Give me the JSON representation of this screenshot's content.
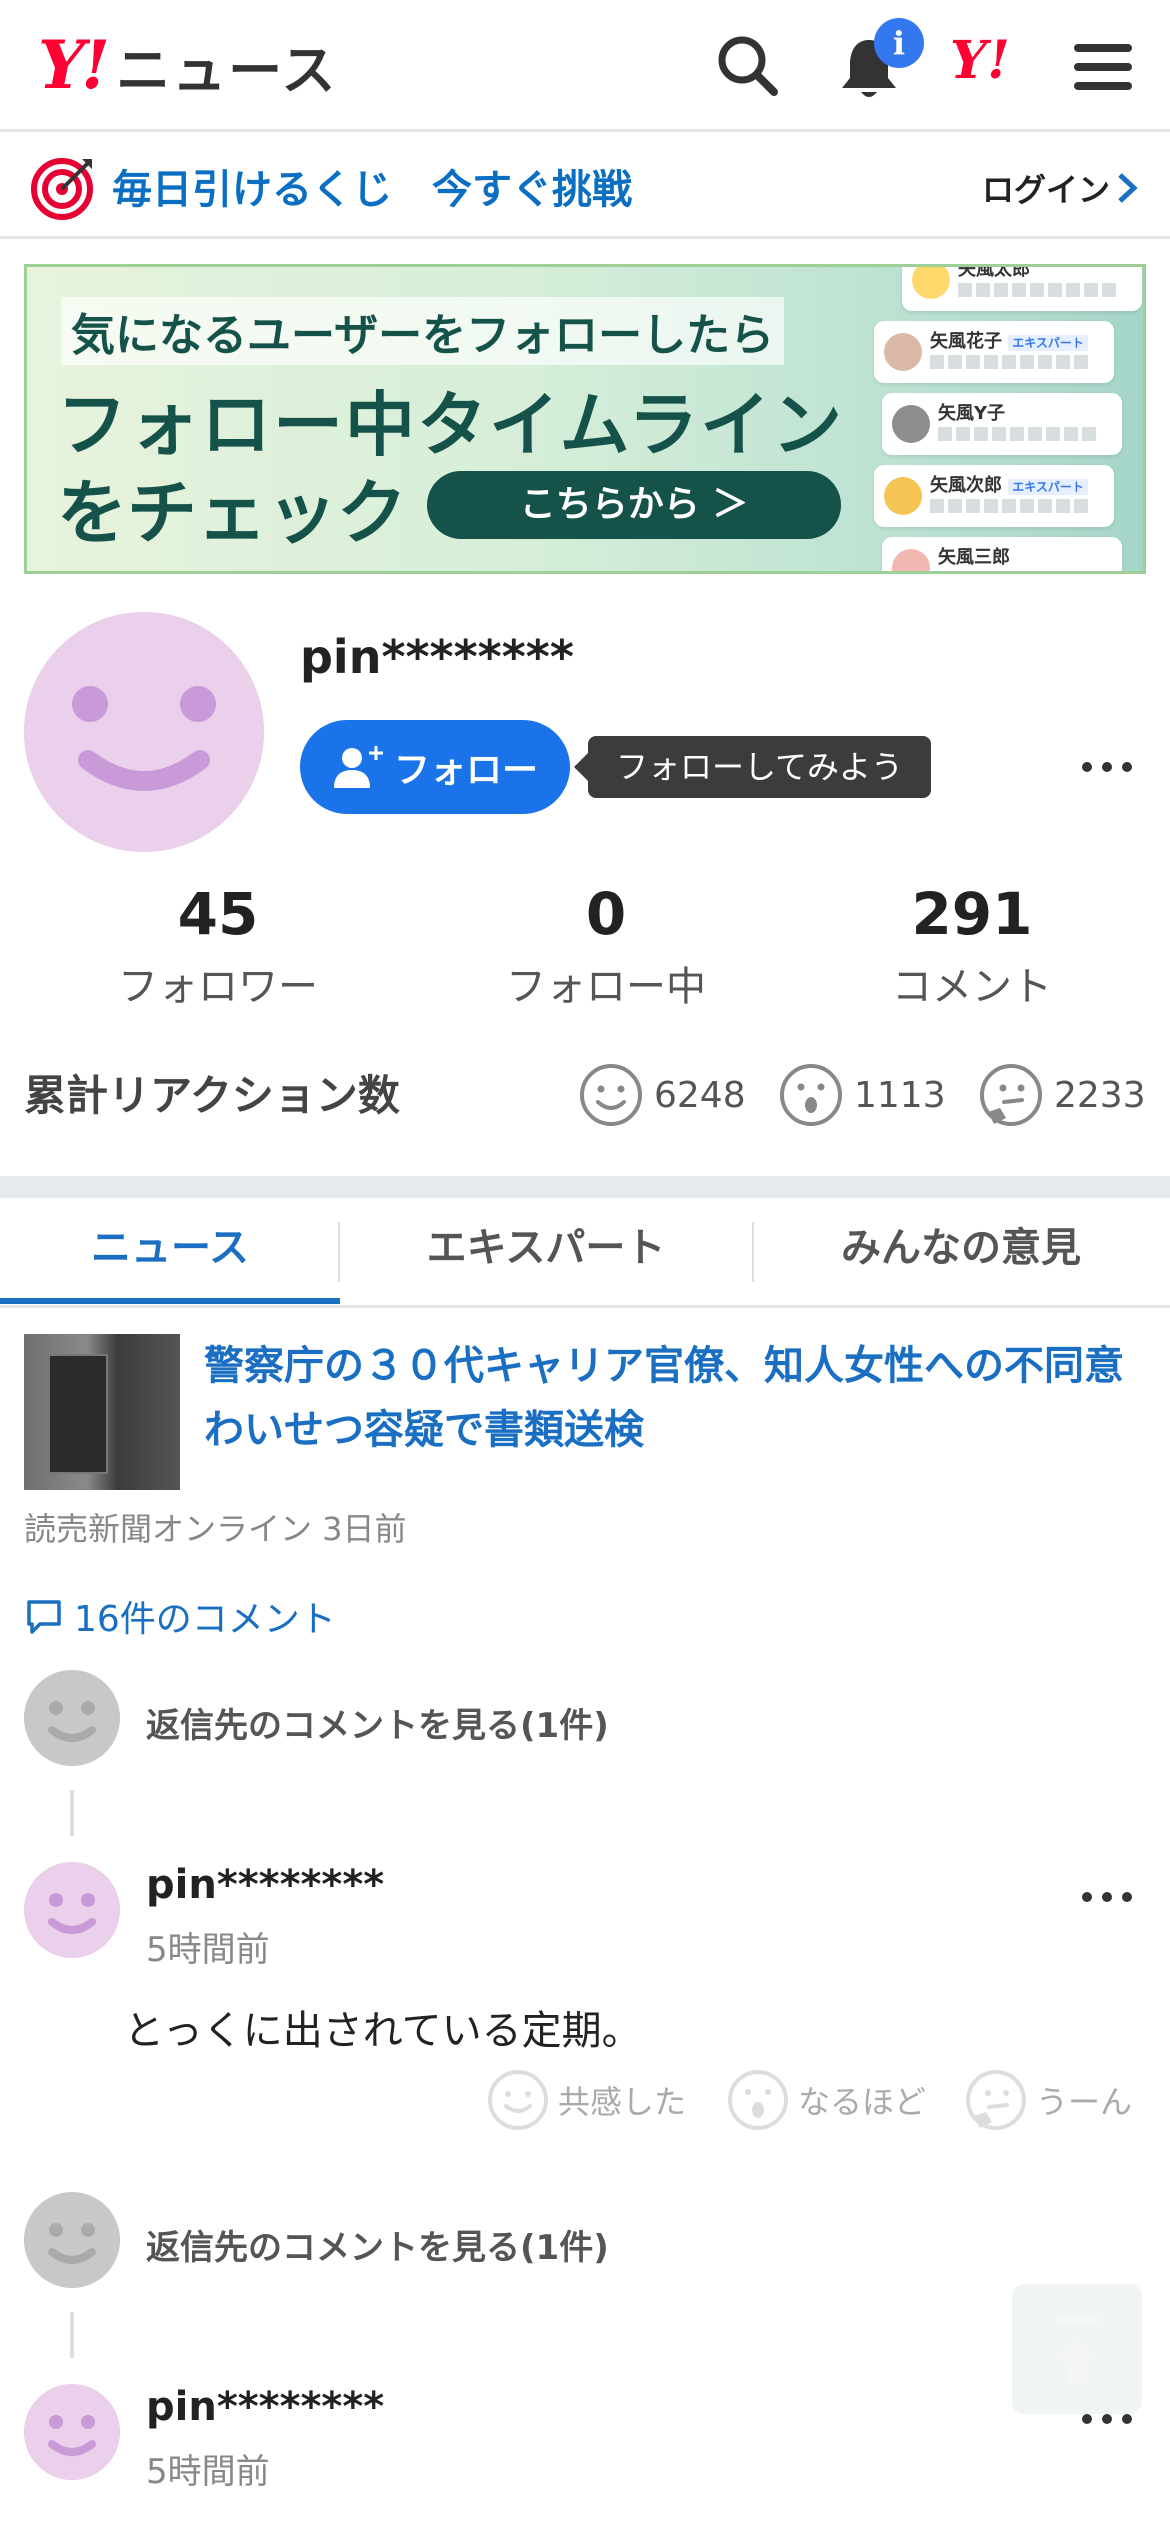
{
  "header": {
    "logo_mark": "Y!",
    "logo_text": "ニュース",
    "notification_badge": "i",
    "yj_mark": "Y!"
  },
  "lottery": {
    "text": "毎日引けるくじ　今すぐ挑戦",
    "login": "ログイン"
  },
  "banner": {
    "line1": "気になるユーザーをフォローしたら",
    "line2": "フォロー中タイムライン",
    "line3": "をチェック",
    "cta": "こちらから ＞",
    "cards": [
      "矢風太郎",
      "矢風花子",
      "矢風Y子",
      "矢風次郎",
      "矢風三郎"
    ],
    "expert_tag": "エキスパート"
  },
  "profile": {
    "username": "pin********",
    "follow_label": "フォロー",
    "tooltip": "フォローしてみよう",
    "stats": [
      {
        "num": "45",
        "label": "フォロワー"
      },
      {
        "num": "0",
        "label": "フォロー中"
      },
      {
        "num": "291",
        "label": "コメント"
      }
    ],
    "reactions_title": "累計リアクション数",
    "reactions": [
      {
        "icon": "smile-icon",
        "count": "6248"
      },
      {
        "icon": "surprised-icon",
        "count": "1113"
      },
      {
        "icon": "thinking-icon",
        "count": "2233"
      }
    ]
  },
  "tabs": [
    {
      "label": "ニュース",
      "active": true
    },
    {
      "label": "エキスパート",
      "active": false
    },
    {
      "label": "みんなの意見",
      "active": false
    }
  ],
  "article": {
    "title": "警察庁の３０代キャリア官僚、知人女性への不同意わいせつ容疑で書類送検",
    "source": "読売新聞オンライン 3日前",
    "comment_count": "16件のコメント"
  },
  "comments": [
    {
      "reply_link": "返信先のコメントを見る(1件)",
      "user": "pin********",
      "time": "5時間前",
      "body": "とっくに出されている定期。",
      "reactions": [
        "共感した",
        "なるほど",
        "うーん"
      ]
    },
    {
      "reply_link": "返信先のコメントを見る(1件)",
      "user": "pin********",
      "time": "5時間前"
    }
  ],
  "colors": {
    "accent": "#1a73e8",
    "link": "#1a6fc2",
    "brand_red": "#ff0033"
  }
}
